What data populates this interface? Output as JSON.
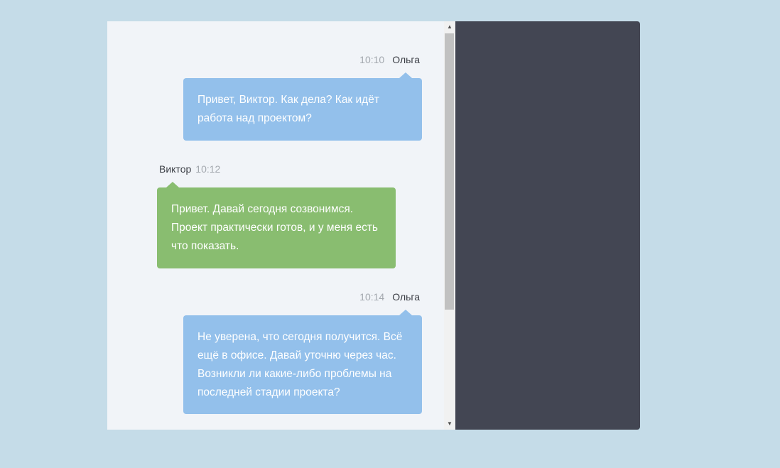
{
  "messages": [
    {
      "direction": "outgoing",
      "author": "Ольга",
      "time": "10:10",
      "lines": [
        "Привет, Виктор. Как дела? Как идёт",
        "работа над проектом?"
      ]
    },
    {
      "direction": "incoming",
      "author": "Виктор",
      "time": "10:12",
      "lines": [
        "Привет. Давай сегодня созвонимся.",
        "Проект практически готов, и у меня есть",
        "что показать."
      ]
    },
    {
      "direction": "outgoing",
      "author": "Ольга",
      "time": "10:14",
      "lines": [
        "Не уверена, что сегодня получится. Всё",
        "ещё в офисе. Давай уточню через час.",
        "Возникли ли какие-либо проблемы на",
        "последней стадии проекта?"
      ]
    }
  ],
  "scrollbar": {
    "up_icon": "arrow-up-icon",
    "down_icon": "arrow-down-icon",
    "up_glyph": "▲",
    "down_glyph": "▼"
  },
  "colors": {
    "page_background": "#c5dce8",
    "chat_background": "#f1f4f8",
    "outgoing_bubble": "#93c0eb",
    "incoming_bubble": "#89bd70",
    "dark_panel": "#434653",
    "time_text": "#a3a8ae",
    "author_text": "#3c3f46"
  }
}
